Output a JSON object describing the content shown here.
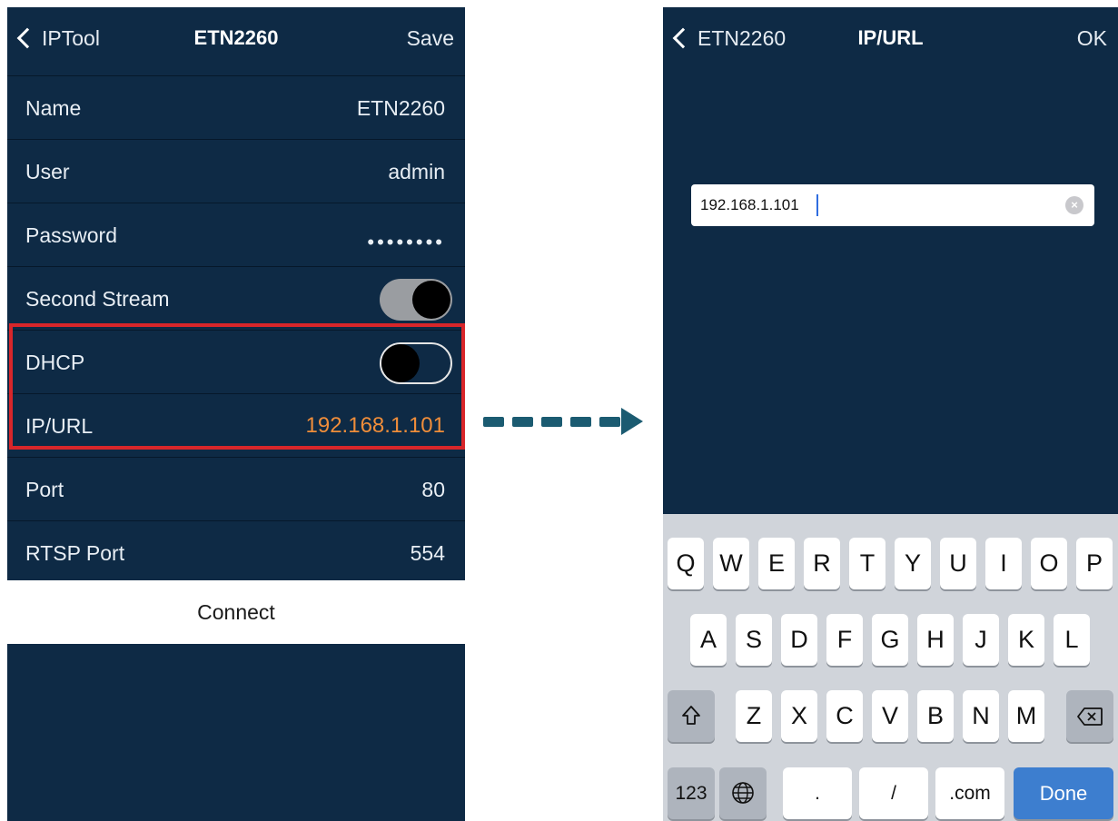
{
  "left": {
    "nav": {
      "back_label": "IPTool",
      "title": "ETN2260",
      "right_label": "Save"
    },
    "rows": [
      {
        "label": "Name",
        "value": "ETN2260"
      },
      {
        "label": "User",
        "value": "admin"
      },
      {
        "label": "Password",
        "value": "••••••••"
      },
      {
        "label": "Second Stream",
        "toggle": true
      },
      {
        "label": "DHCP",
        "toggle": false
      },
      {
        "label": "IP/URL",
        "value": "192.168.1.101"
      },
      {
        "label": "Port",
        "value": "80"
      },
      {
        "label": "RTSP Port",
        "value": "554"
      }
    ],
    "connect_label": "Connect"
  },
  "right": {
    "nav": {
      "back_label": "ETN2260",
      "title": "IP/URL",
      "right_label": "OK"
    },
    "field_value": "192.168.1.101"
  },
  "keyboard": {
    "row1": [
      "Q",
      "W",
      "E",
      "R",
      "T",
      "Y",
      "U",
      "I",
      "O",
      "P"
    ],
    "row2": [
      "A",
      "S",
      "D",
      "F",
      "G",
      "H",
      "J",
      "K",
      "L"
    ],
    "row3": [
      "Z",
      "X",
      "C",
      "V",
      "B",
      "N",
      "M"
    ],
    "bottom": {
      "numbers": "123",
      "period": ".",
      "slash": "/",
      "dotcom": ".com",
      "done": "Done"
    }
  },
  "icons": {
    "back": "chevron-left-icon",
    "clear": "clear-circle-icon",
    "shift": "shift-icon",
    "backspace": "backspace-icon",
    "globe": "globe-icon",
    "flow": "dashed-arrow-right-icon"
  },
  "colors": {
    "screen_bg": "#0e2a45",
    "accent_value": "#ef8d3a",
    "highlight": "#d8262a",
    "done_key": "#3d7ecf",
    "arrow": "#1b5b71"
  }
}
